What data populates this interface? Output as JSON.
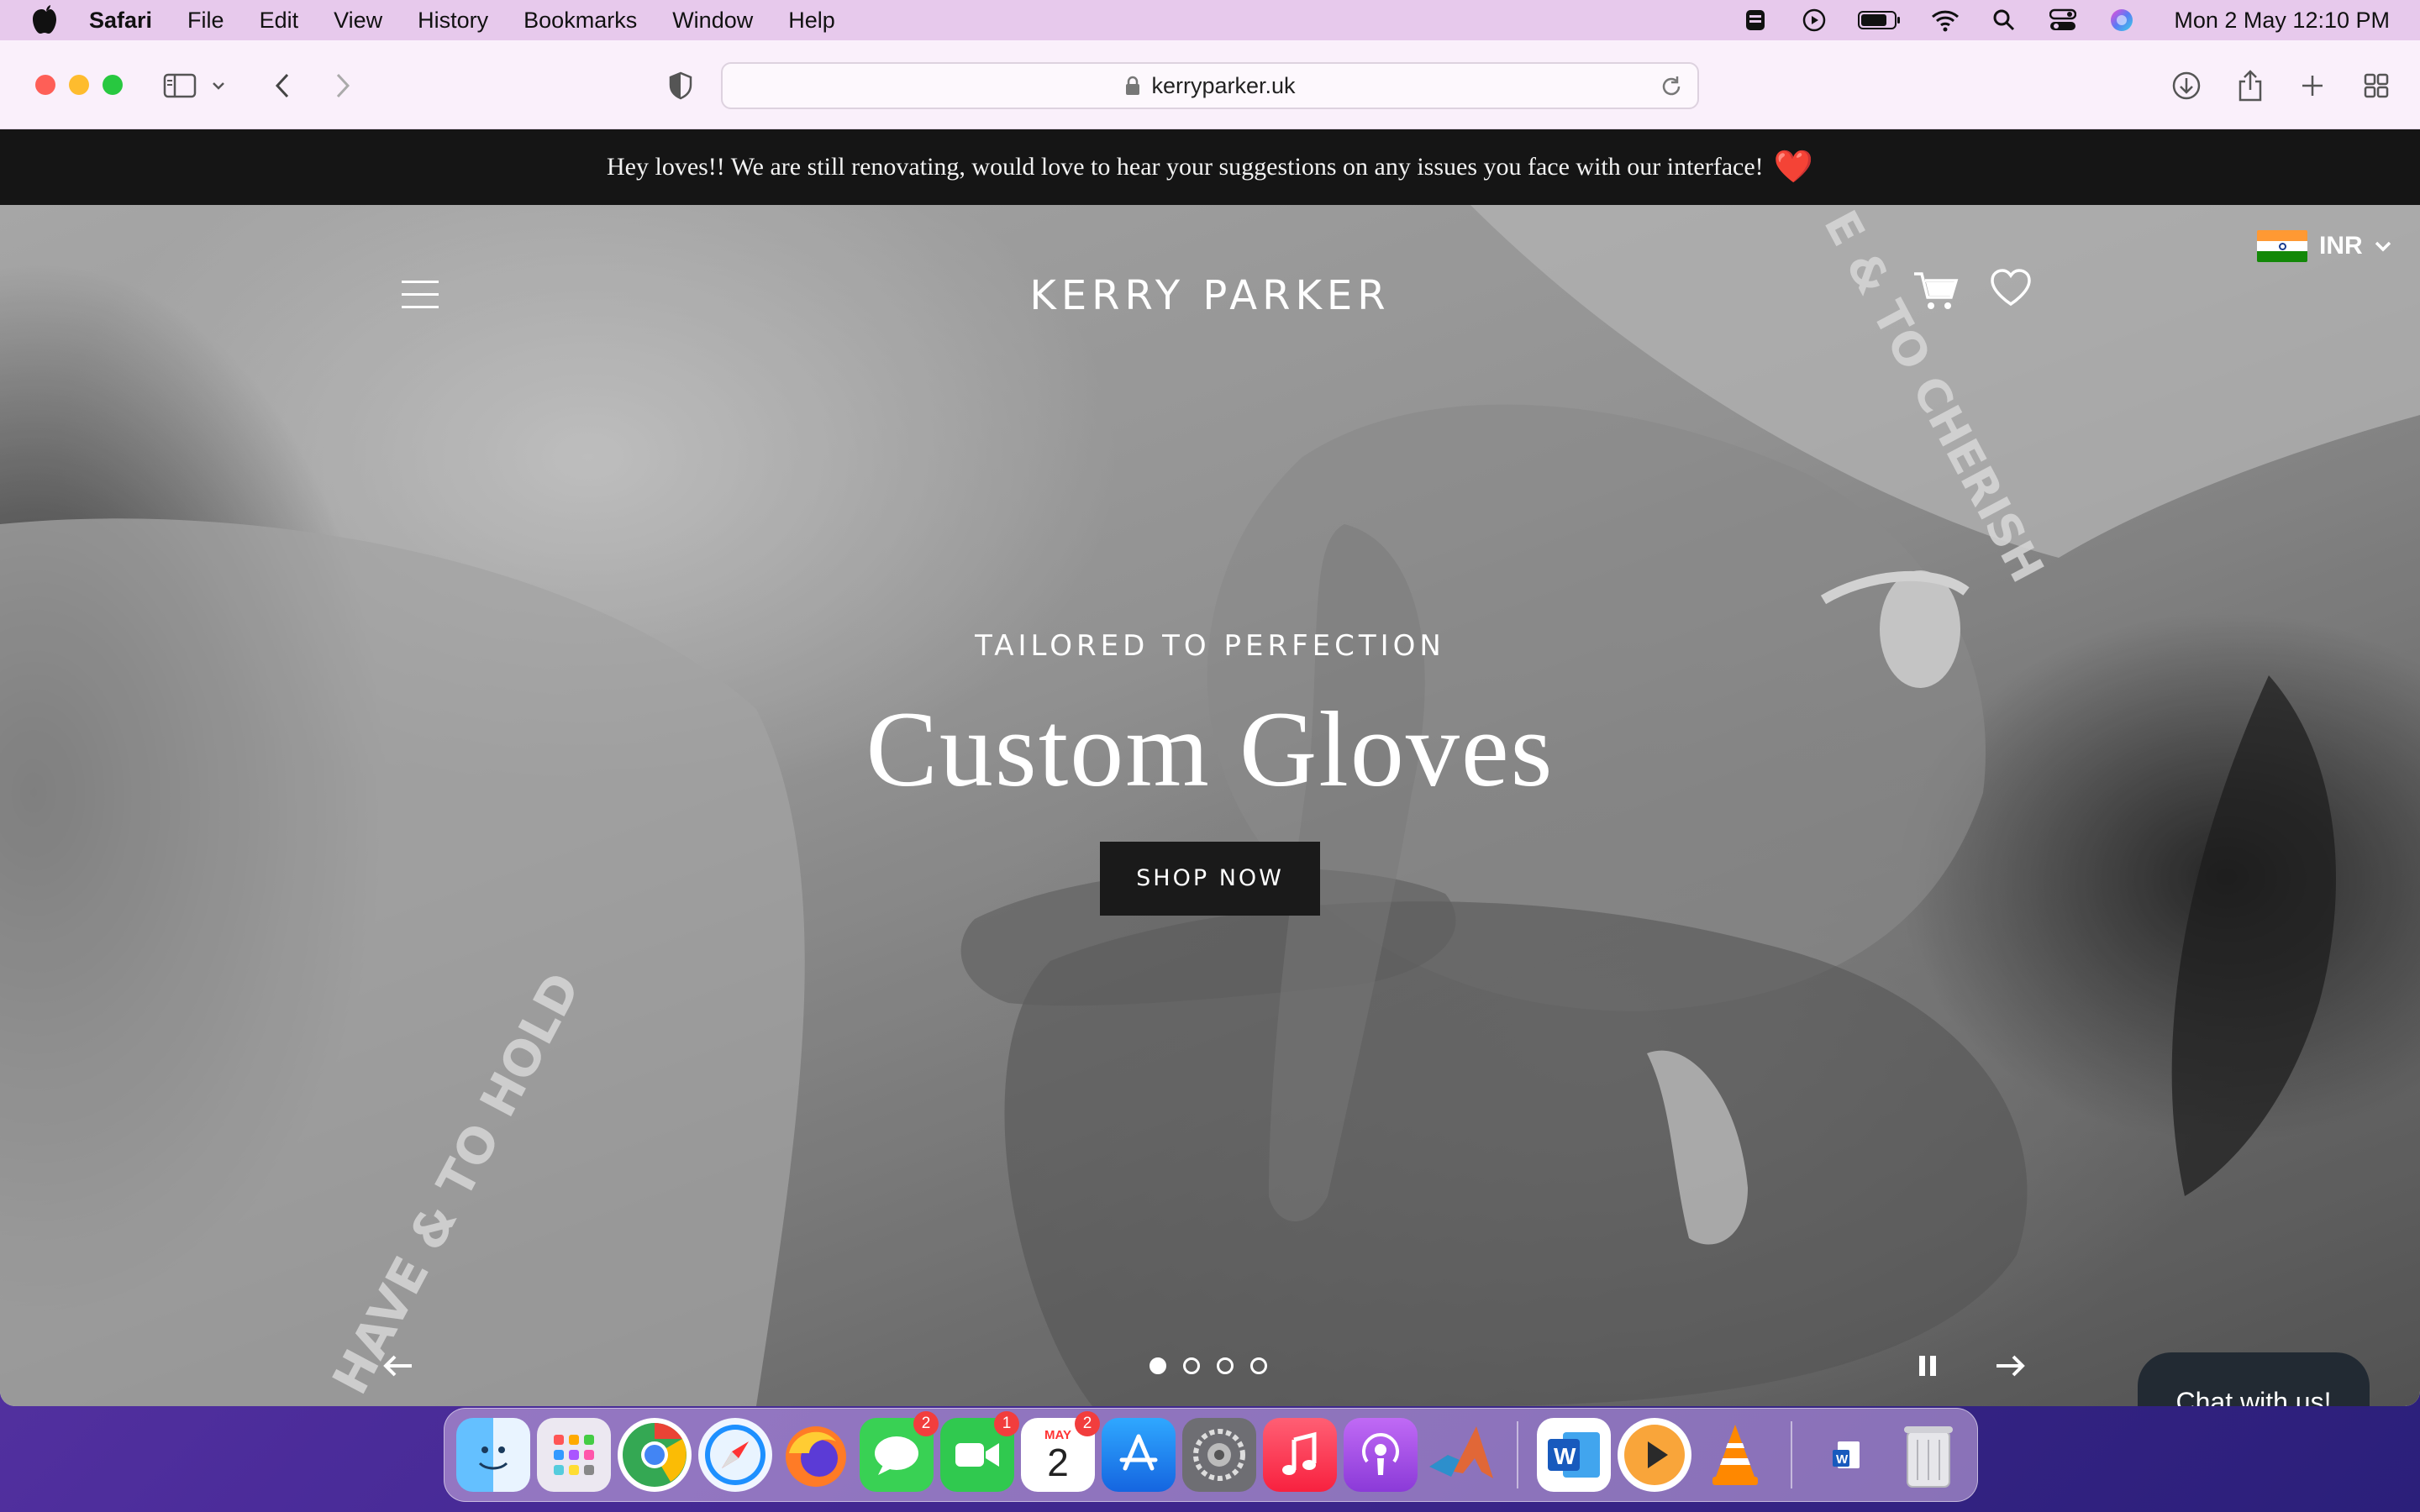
{
  "menubar": {
    "app_name": "Safari",
    "items": [
      "File",
      "Edit",
      "View",
      "History",
      "Bookmarks",
      "Window",
      "Help"
    ],
    "clock": "Mon 2 May  12:10 PM",
    "status_icons": [
      "keyboard-brightness-icon",
      "play-circle-icon",
      "battery-icon",
      "wifi-icon",
      "spotlight-search-icon",
      "control-center-icon",
      "siri-icon"
    ]
  },
  "browser": {
    "url": "kerryparker.uk"
  },
  "announcement": {
    "text": "Hey loves!! We are still renovating, would love to hear your suggestions on any issues you face with our interface!",
    "heart": "❤️"
  },
  "header": {
    "brand": "KERRY PARKER",
    "currency": "INR"
  },
  "hero": {
    "eyebrow": "TAILORED TO PERFECTION",
    "headline": "Custom Gloves",
    "cta": "SHOP NOW",
    "slide_count": 4,
    "active_slide": 1,
    "photo_text": [
      "HAVE & TO HOLD",
      "E & TO CHERISH"
    ]
  },
  "chat": {
    "label": "Chat with us!"
  },
  "dock": {
    "apps": [
      {
        "name": "finder",
        "color": "#3aa0f2"
      },
      {
        "name": "launchpad",
        "color": "#e9e4ee"
      },
      {
        "name": "chrome",
        "color": "#ffffff"
      },
      {
        "name": "safari",
        "color": "#eaf3ff"
      },
      {
        "name": "firefox",
        "color": "#ff7b26"
      },
      {
        "name": "messages",
        "color": "#39d154",
        "badge": "2"
      },
      {
        "name": "facetime",
        "color": "#30c94f",
        "badge": "1"
      },
      {
        "name": "calendar",
        "color": "#ffffff",
        "badge": "2",
        "month": "MAY",
        "day": "2"
      },
      {
        "name": "app-store",
        "color": "#1f8ef5"
      },
      {
        "name": "system-preferences",
        "color": "#8a8a8f"
      },
      {
        "name": "music",
        "color": "#fb3c55"
      },
      {
        "name": "podcasts",
        "color": "#9b4fe0"
      },
      {
        "name": "matlab",
        "color": "#ffffff"
      },
      {
        "name": "word",
        "color": "#ffffff"
      },
      {
        "name": "infuse",
        "color": "#ffffff"
      },
      {
        "name": "vlc",
        "color": "#ff8800"
      },
      {
        "name": "word-document",
        "color": "#d9d2e8"
      },
      {
        "name": "trash",
        "color": "#d9d9de"
      }
    ]
  }
}
